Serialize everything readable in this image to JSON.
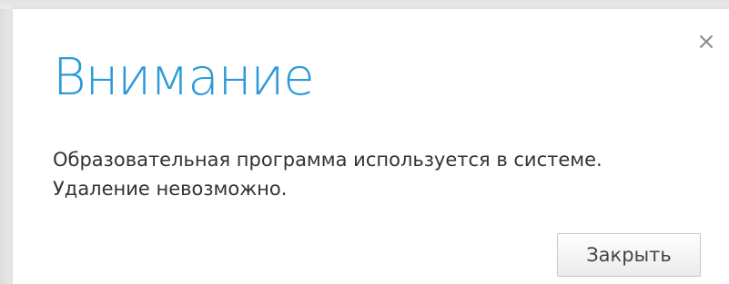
{
  "dialog": {
    "title": "Внимание",
    "message": "Образовательная программа используется в системе. Удаление невозможно.",
    "close_icon": "close-icon",
    "close_icon_glyph": "×",
    "close_button_label": "Закрыть"
  },
  "colors": {
    "title": "#2b9ad8",
    "text": "#333333",
    "close_icon": "#8f8f8f",
    "backdrop": "#e9e9e9"
  }
}
